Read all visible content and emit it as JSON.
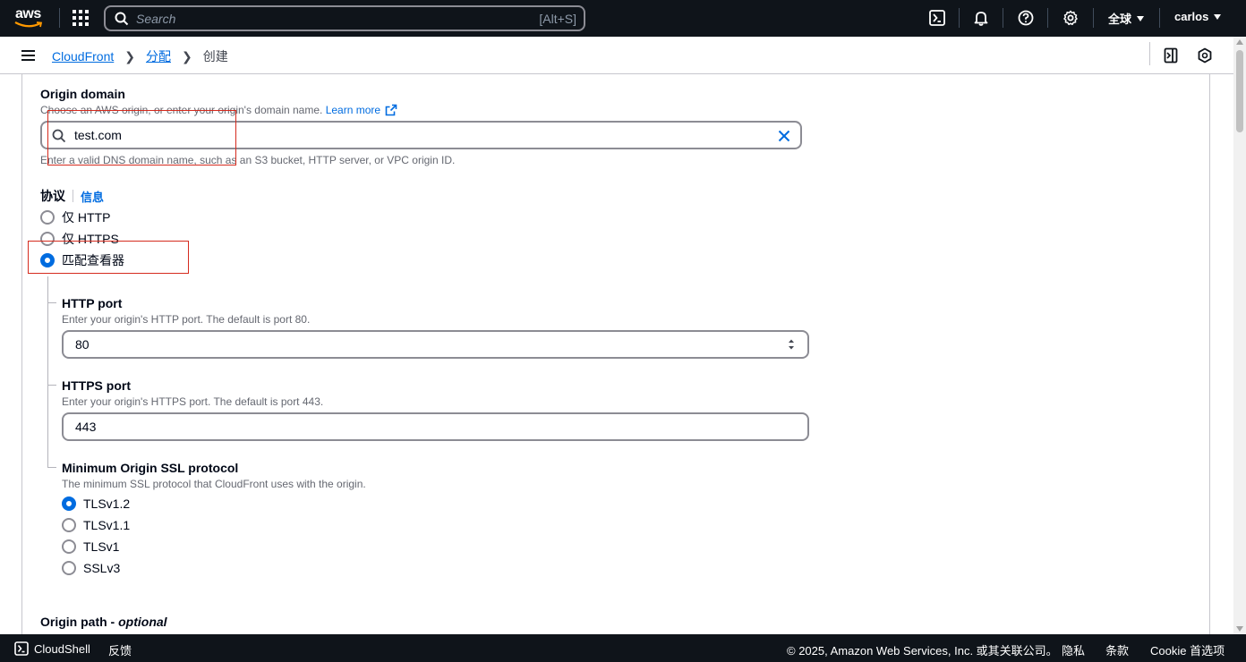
{
  "topnav": {
    "logo_text": "aws",
    "search_placeholder": "Search",
    "search_shortcut": "[Alt+S]",
    "region_label": "全球",
    "user_label": "carlos"
  },
  "breadcrumb": {
    "items": [
      "CloudFront",
      "分配"
    ],
    "current": "创建"
  },
  "form": {
    "origin_domain": {
      "label": "Origin domain",
      "description": "Choose an AWS origin, or enter your origin's domain name.",
      "learn_more": "Learn more",
      "value": "test.com",
      "hint": "Enter a valid DNS domain name, such as an S3 bucket, HTTP server, or VPC origin ID."
    },
    "protocol": {
      "label": "协议",
      "info": "信息",
      "options": [
        "仅 HTTP",
        "仅 HTTPS",
        "匹配查看器"
      ],
      "selected": "匹配查看器"
    },
    "http_port": {
      "label": "HTTP port",
      "description": "Enter your origin's HTTP port. The default is port 80.",
      "value": "80"
    },
    "https_port": {
      "label": "HTTPS port",
      "description": "Enter your origin's HTTPS port. The default is port 443.",
      "value": "443"
    },
    "ssl_protocol": {
      "label": "Minimum Origin SSL protocol",
      "description": "The minimum SSL protocol that CloudFront uses with the origin.",
      "options": [
        "TLSv1.2",
        "TLSv1.1",
        "TLSv1",
        "SSLv3"
      ],
      "selected": "TLSv1.2"
    },
    "origin_path": {
      "label": "Origin path - ",
      "label_optional": "optional"
    }
  },
  "footer": {
    "cloudshell": "CloudShell",
    "feedback": "反馈",
    "copyright": "© 2025, Amazon Web Services, Inc. 或其关联公司。",
    "privacy": "隐私",
    "terms": "条款",
    "cookie": "Cookie 首选项"
  },
  "colors": {
    "nav_bg": "#0f141a",
    "link": "#006ce0",
    "annotation": "#d52b1e"
  }
}
